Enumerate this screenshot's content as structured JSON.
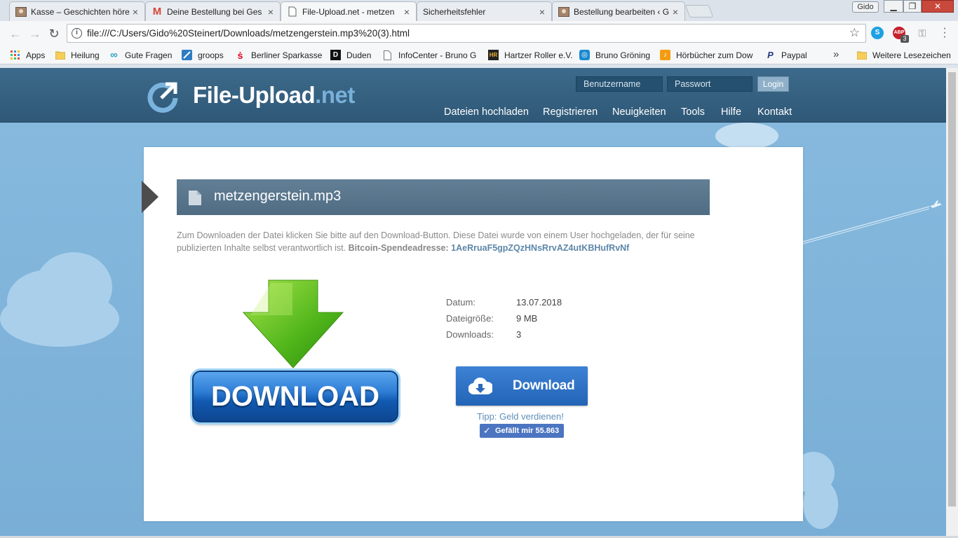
{
  "browser": {
    "tabs": [
      {
        "title": "Kasse – Geschichten höre",
        "favicon": "photo-icon",
        "active": false
      },
      {
        "title": "Deine Bestellung bei Ges",
        "favicon": "gmail-icon",
        "active": false
      },
      {
        "title": "File-Upload.net - metzen",
        "favicon": "document-icon",
        "active": true
      },
      {
        "title": "Sicherheitsfehler",
        "favicon": "none",
        "active": false
      },
      {
        "title": "Bestellung bearbeiten ‹ G",
        "favicon": "photo-icon",
        "active": false
      }
    ],
    "profile_name": "Gido",
    "url": "file:///C:/Users/Gido%20Steinert/Downloads/metzengerstein.mp3%20(3).html",
    "extension_badge": "3",
    "bookmarks": [
      {
        "label": "Apps",
        "icon": "apps-grid-icon"
      },
      {
        "label": "Heilung",
        "icon": "folder-icon"
      },
      {
        "label": "Gute Fragen",
        "icon": "infinity-icon"
      },
      {
        "label": "groops",
        "icon": "groops-icon"
      },
      {
        "label": "Berliner Sparkasse",
        "icon": "sparkasse-icon"
      },
      {
        "label": "Duden",
        "icon": "duden-icon"
      },
      {
        "label": "InfoCenter - Bruno G",
        "icon": "page-icon"
      },
      {
        "label": "Hartzer Roller e.V.",
        "icon": "hr-icon"
      },
      {
        "label": "Bruno Gröning",
        "icon": "globe-icon"
      },
      {
        "label": "Hörbücher zum Dow",
        "icon": "audiobook-icon"
      },
      {
        "label": "Paypal",
        "icon": "paypal-icon"
      }
    ],
    "bookmarks_overflow": "»",
    "other_bookmarks": "Weitere Lesezeichen"
  },
  "site": {
    "logo_main": "File-Upload",
    "logo_tld": ".net",
    "username_placeholder": "Benutzername",
    "password_placeholder": "Passwort",
    "login_label": "Login",
    "nav": [
      "Dateien hochladen",
      "Registrieren",
      "Neuigkeiten",
      "Tools",
      "Hilfe",
      "Kontakt"
    ]
  },
  "file": {
    "name": "metzengerstein.mp3",
    "description": "Zum Downloaden der Datei klicken Sie bitte auf den Download-Button. Diese Datei wurde von einem User hochgeladen, der für seine publizierten Inhalte selbst verantwortlich ist.",
    "btc_label": "Bitcoin-Spendeadresse:",
    "btc_address": "1AeRruaF5gpZQzHNsRrvAZ4utKBHufRvNf",
    "big_button_label": "DOWNLOAD",
    "meta": [
      {
        "label": "Datum:",
        "value": "13.07.2018"
      },
      {
        "label": "Dateigröße:",
        "value": "9 MB"
      },
      {
        "label": "Downloads:",
        "value": "3"
      }
    ],
    "download_label": "Download",
    "tip": "Tipp: Geld verdienen!",
    "like_label": "Gefällt mir 55.863"
  },
  "colors": {
    "header": "#3d6a8b",
    "accent": "#79b0d9",
    "download_button": "#2f72c6",
    "sky": "#84b8dd"
  }
}
